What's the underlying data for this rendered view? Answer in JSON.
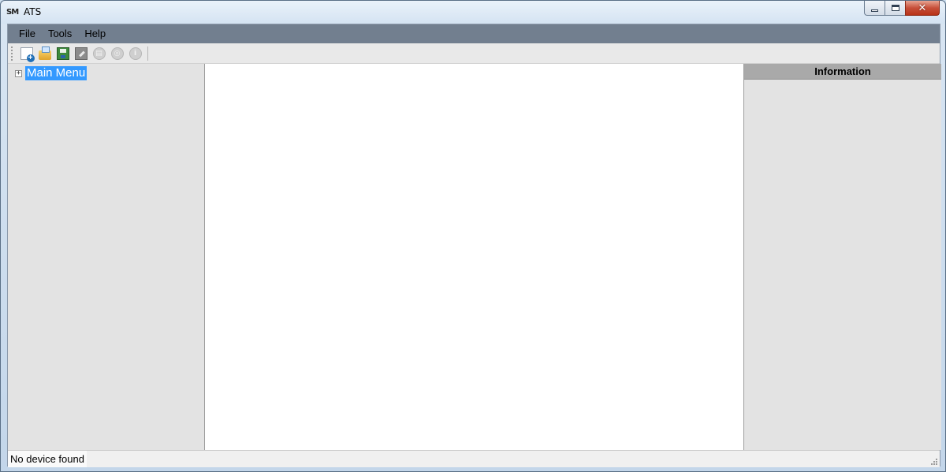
{
  "window": {
    "icon_text": "SM",
    "title": "ATS",
    "controls": {
      "minimize": "minimize",
      "maximize": "maximize",
      "close": "✕"
    }
  },
  "menu": {
    "items": [
      {
        "label": "File"
      },
      {
        "label": "Tools"
      },
      {
        "label": "Help"
      }
    ]
  },
  "toolbar": {
    "buttons": [
      {
        "icon": "new-document-icon",
        "enabled": true
      },
      {
        "icon": "open-folder-icon",
        "enabled": true
      },
      {
        "icon": "save-icon",
        "enabled": true
      },
      {
        "icon": "edit-icon",
        "enabled": true
      },
      {
        "icon": "device-icon",
        "enabled": false
      },
      {
        "icon": "connect-icon",
        "enabled": false
      },
      {
        "icon": "info-icon",
        "enabled": false
      }
    ]
  },
  "tree": {
    "root": {
      "label": "Main Menu",
      "expander": "+"
    }
  },
  "info_panel": {
    "title": "Information"
  },
  "status": {
    "text": "No device found"
  }
}
